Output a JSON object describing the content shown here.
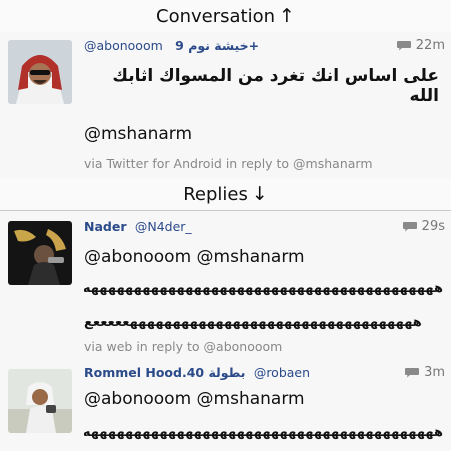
{
  "conversation_header": {
    "label": "Conversation",
    "arrow": "↑"
  },
  "replies_header": {
    "label": "Replies",
    "arrow": "↓"
  },
  "original_tweet": {
    "display_name": "خيشة نوم 9+",
    "handle": "@abonooom",
    "time": "22m",
    "text_arabic": "على اساس انك تغرد من المسواك اثابك الله",
    "mention": "@mshanarm",
    "via": "via Twitter for Android in reply to @mshanarm"
  },
  "replies": [
    {
      "display_name": "Nader",
      "handle": "@N4der_",
      "time": "29s",
      "mentions": "@abonooom @mshanarm",
      "laugh_line_1": "هههههههههههههههههههههههههههههههههههههههههه",
      "laugh_line_2": "ههههههههههههههههههههههههههههههههههعععععع",
      "via": "via web in reply to @abonooom"
    },
    {
      "display_name": "Rommel Hood.40 بطولة",
      "handle": "@robaen",
      "time": "3m",
      "mentions": "@abonooom @mshanarm",
      "laugh_line_1": "هههههههههههههههههههههههههههههههههههههههههه"
    }
  ],
  "colors": {
    "link": "#2b4a8a",
    "meta_gray": "#888888",
    "background": "#f4f4f4"
  }
}
